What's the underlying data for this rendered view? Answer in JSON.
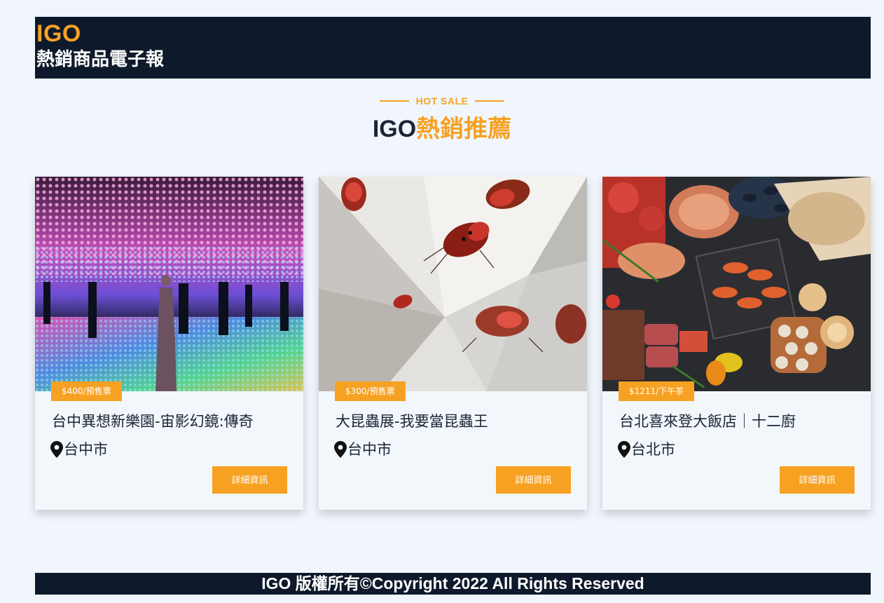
{
  "header": {
    "brand": "IGO",
    "subtitle": "熱銷商品電子報"
  },
  "section": {
    "eyebrow": "HOT SALE",
    "title_brand": "IGO",
    "title_rest": "熱銷推薦"
  },
  "cards": [
    {
      "price": "$400/預售票",
      "title": "台中異想新樂園-宙影幻鏡:傳奇",
      "location": "台中市",
      "button": "詳細資訊",
      "image": "digital-lantern-art-installation-photo"
    },
    {
      "price": "$300/預售票",
      "title": "大昆蟲展-我要當昆蟲王",
      "location": "台中市",
      "button": "詳細資訊",
      "image": "mirrored-beetle-exhibit-photo"
    },
    {
      "price": "$1211/下午茶",
      "title": "台北喜來登大飯店｜十二廚",
      "location": "台北市",
      "button": "詳細資訊",
      "image": "seafood-buffet-platter-photo"
    }
  ],
  "footer": {
    "text": "IGO 版權所有©Copyright 2022 All Rights Reserved"
  },
  "colors": {
    "accent": "#f7a123",
    "navy": "#0e1a2b",
    "background": "#f0f6fc"
  }
}
